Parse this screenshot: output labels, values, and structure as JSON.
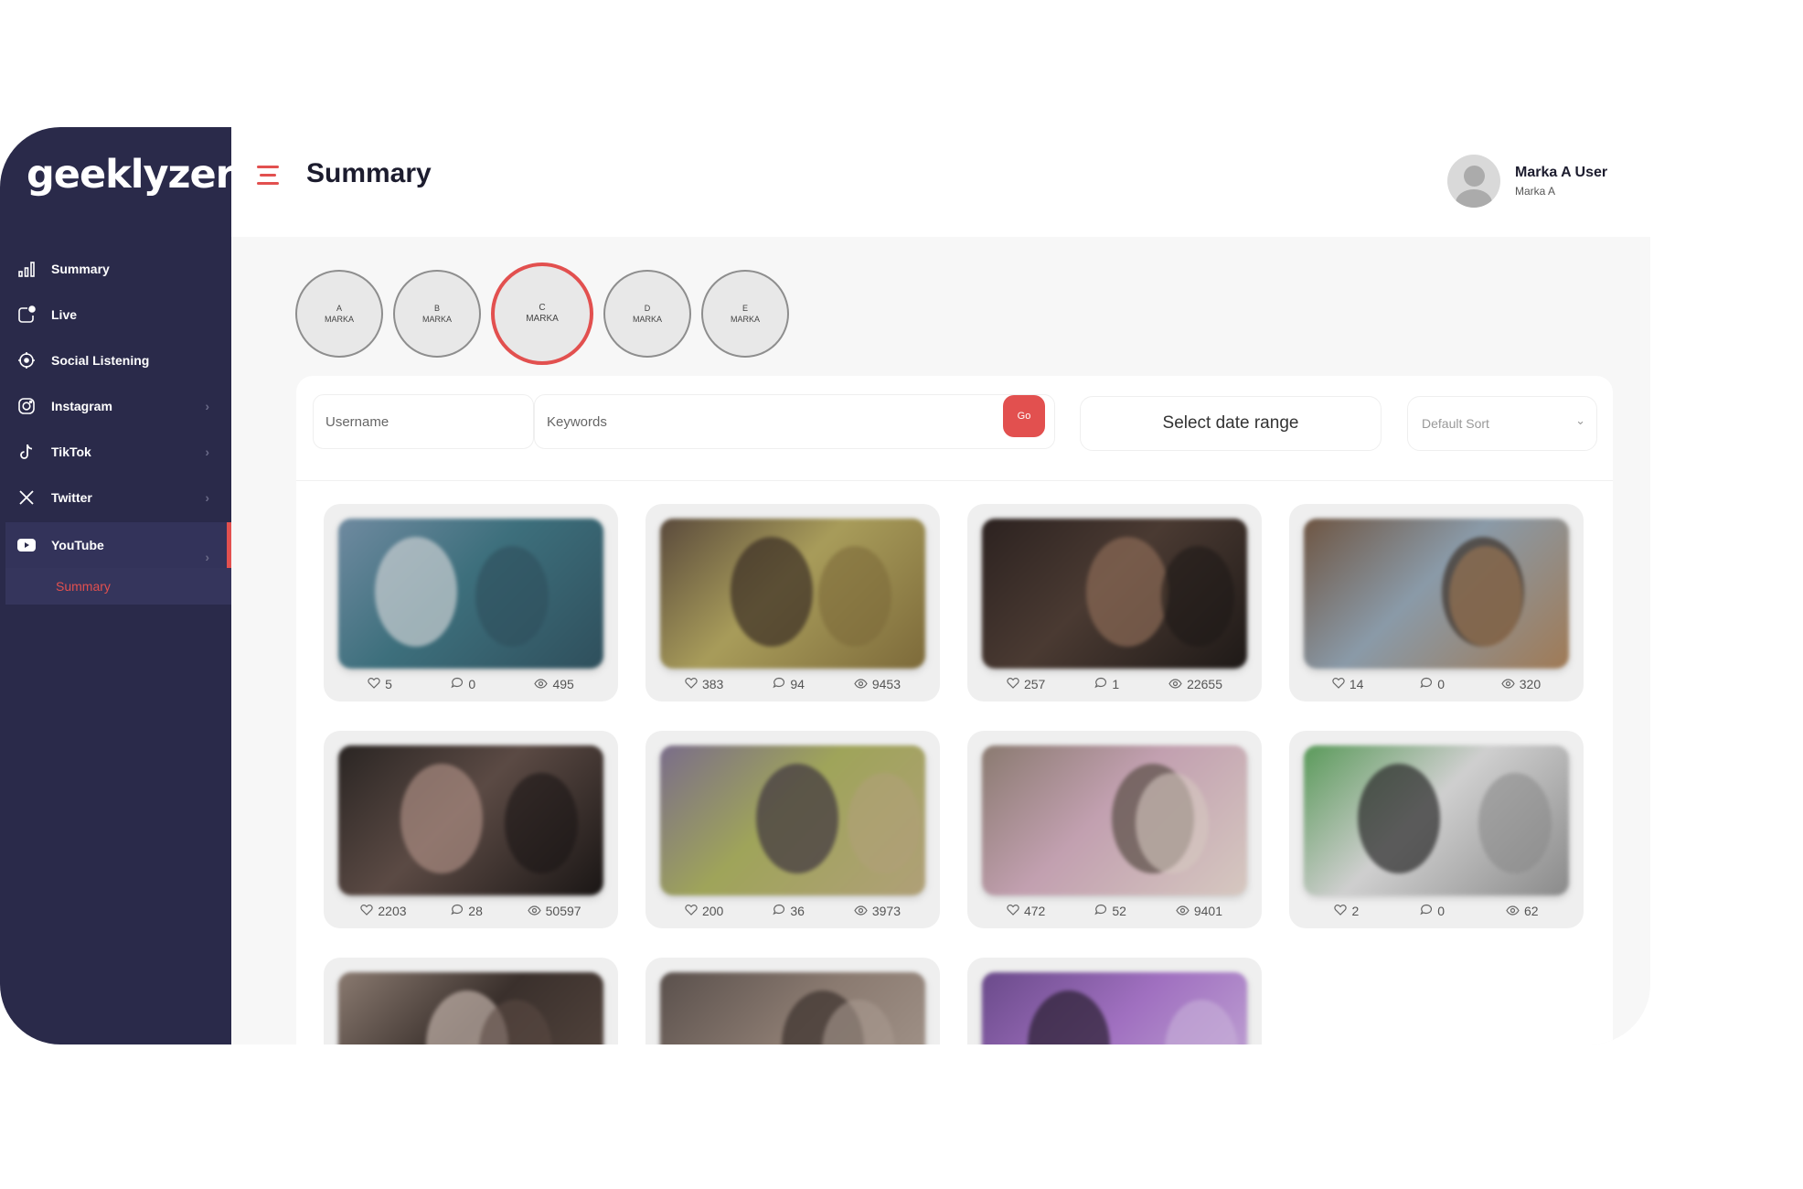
{
  "app": {
    "logo": "geeklyzer"
  },
  "sidebar": {
    "items": [
      {
        "label": "Summary",
        "icon": "bar-chart-icon",
        "chevron": false
      },
      {
        "label": "Live",
        "icon": "live-icon",
        "chevron": false
      },
      {
        "label": "Social Listening",
        "icon": "target-icon",
        "chevron": false
      },
      {
        "label": "Instagram",
        "icon": "instagram-icon",
        "chevron": true
      },
      {
        "label": "TikTok",
        "icon": "tiktok-icon",
        "chevron": true
      },
      {
        "label": "Twitter",
        "icon": "x-icon",
        "chevron": true
      },
      {
        "label": "YouTube",
        "icon": "youtube-icon",
        "chevron": true,
        "active": true
      }
    ],
    "sub_items": [
      {
        "label": "Summary",
        "active": true
      }
    ]
  },
  "header": {
    "title": "Summary",
    "user": {
      "name": "Marka A User",
      "subtitle": "Marka A"
    }
  },
  "brands": [
    {
      "letter": "A",
      "label": "MARKA",
      "active": false
    },
    {
      "letter": "B",
      "label": "MARKA",
      "active": false
    },
    {
      "letter": "C",
      "label": "MARKA",
      "active": true
    },
    {
      "letter": "D",
      "label": "MARKA",
      "active": false
    },
    {
      "letter": "E",
      "label": "MARKA",
      "active": false
    }
  ],
  "filters": {
    "username_placeholder": "Username",
    "keywords_placeholder": "Keywords",
    "go_label": "Go",
    "date_label": "Select date range",
    "sort_label": "Default Sort"
  },
  "videos": [
    {
      "likes": "5",
      "comments": "0",
      "views": "495"
    },
    {
      "likes": "383",
      "comments": "94",
      "views": "9453"
    },
    {
      "likes": "257",
      "comments": "1",
      "views": "22655"
    },
    {
      "likes": "14",
      "comments": "0",
      "views": "320"
    },
    {
      "likes": "2203",
      "comments": "28",
      "views": "50597"
    },
    {
      "likes": "200",
      "comments": "36",
      "views": "3973"
    },
    {
      "likes": "472",
      "comments": "52",
      "views": "9401"
    },
    {
      "likes": "2",
      "comments": "0",
      "views": "62"
    },
    {
      "likes": "",
      "comments": "",
      "views": ""
    },
    {
      "likes": "",
      "comments": "",
      "views": ""
    },
    {
      "likes": "",
      "comments": "",
      "views": ""
    }
  ],
  "colors": {
    "accent": "#e2504f",
    "sidebar": "#2a2a4a",
    "content_bg": "#f7f7f7"
  }
}
